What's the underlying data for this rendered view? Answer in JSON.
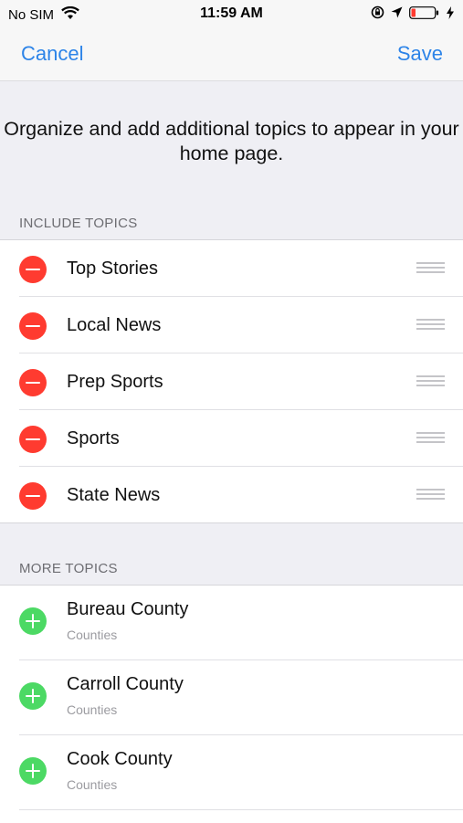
{
  "status": {
    "carrier": "No SIM",
    "time": "11:59 AM"
  },
  "nav": {
    "cancel_label": "Cancel",
    "save_label": "Save"
  },
  "intro_text": "Organize and add additional topics to appear in your home page.",
  "include_header": "INCLUDE TOPICS",
  "include_topics": [
    {
      "label": "Top Stories"
    },
    {
      "label": "Local News"
    },
    {
      "label": "Prep Sports"
    },
    {
      "label": "Sports"
    },
    {
      "label": "State News"
    }
  ],
  "more_header": "MORE TOPICS",
  "more_topics": [
    {
      "title": "Bureau County",
      "subtitle": "Counties"
    },
    {
      "title": "Carroll County",
      "subtitle": "Counties"
    },
    {
      "title": "Cook County",
      "subtitle": "Counties"
    }
  ],
  "icons": {
    "wifi": "wifi-icon",
    "location": "location-arrow-icon",
    "orientation_lock": "orientation-lock-icon",
    "battery": "battery-icon",
    "charging": "bolt-icon",
    "remove": "minus-circle-icon",
    "add": "plus-circle-icon",
    "reorder": "drag-handle-icon"
  },
  "colors": {
    "accent": "#2d84e8",
    "remove": "#ff3b30",
    "add": "#4cd964",
    "battery_low": "#ff3b30"
  }
}
